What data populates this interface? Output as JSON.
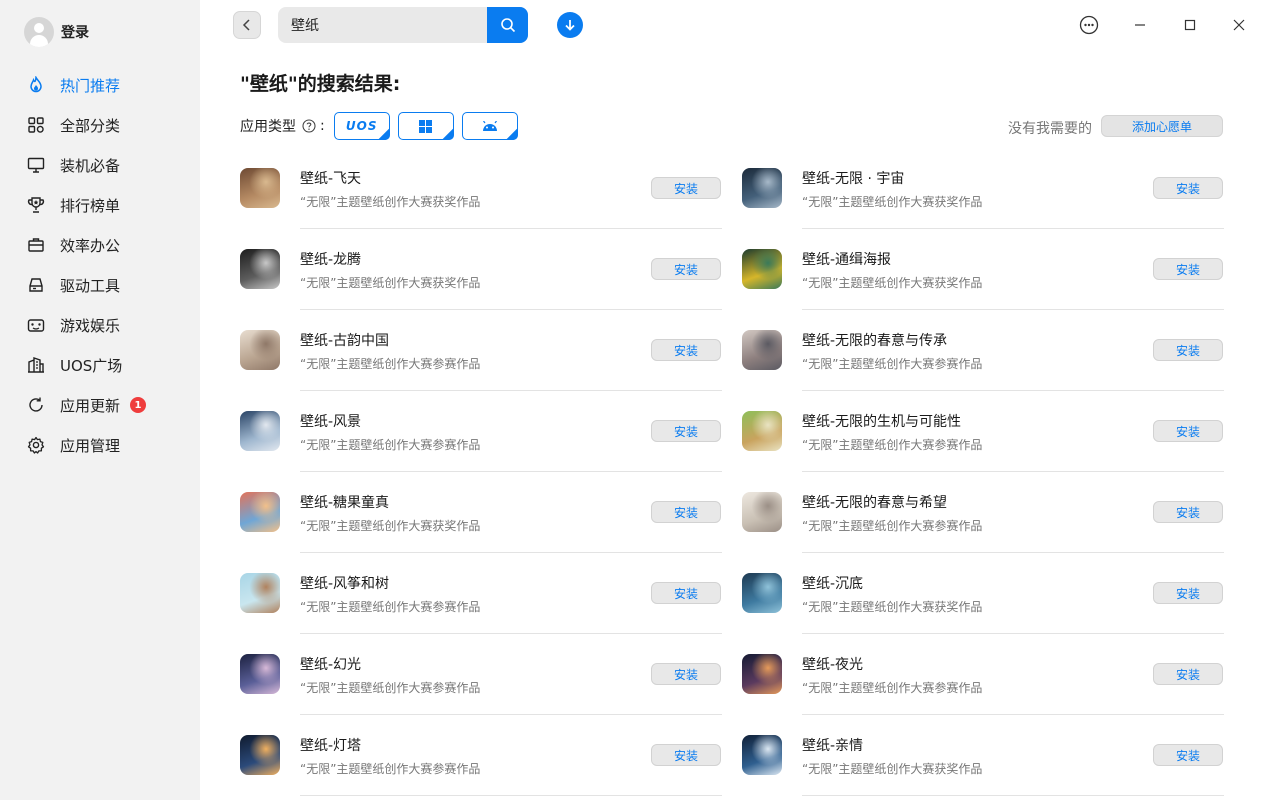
{
  "sidebar": {
    "login_label": "登录",
    "items": [
      {
        "label": "热门推荐",
        "icon": "flame-icon",
        "active": true
      },
      {
        "label": "全部分类",
        "icon": "grid-icon"
      },
      {
        "label": "装机必备",
        "icon": "monitor-icon"
      },
      {
        "label": "排行榜单",
        "icon": "trophy-icon"
      },
      {
        "label": "效率办公",
        "icon": "briefcase-icon"
      },
      {
        "label": "驱动工具",
        "icon": "drive-icon"
      },
      {
        "label": "游戏娱乐",
        "icon": "gamepad-icon"
      },
      {
        "label": "UOS广场",
        "icon": "buildings-icon"
      },
      {
        "label": "应用更新",
        "icon": "refresh-icon",
        "badge": "1"
      },
      {
        "label": "应用管理",
        "icon": "gear-icon"
      }
    ]
  },
  "search": {
    "value": "壁纸"
  },
  "results": {
    "title": "\"壁纸\"的搜索结果:",
    "filter_label": "应用类型",
    "filter_colon": ":",
    "type_chips": [
      {
        "label": "UOS",
        "icon": "uos-logo"
      },
      {
        "label": "",
        "icon": "windows-icon"
      },
      {
        "label": "",
        "icon": "android-icon"
      }
    ],
    "wish_text": "没有我需要的",
    "wish_button": "添加心愿单"
  },
  "install_label": "安装",
  "apps": [
    {
      "name": "壁纸-飞天",
      "desc": "“无限”主题壁纸创作大赛获奖作品",
      "colors": [
        "#6e4a33",
        "#b58a63",
        "#d9b98f"
      ]
    },
    {
      "name": "壁纸-无限 · 宇宙",
      "desc": "“无限”主题壁纸创作大赛获奖作品",
      "colors": [
        "#1b2a3a",
        "#44607a",
        "#a7b9c9"
      ]
    },
    {
      "name": "壁纸-龙腾",
      "desc": "“无限”主题壁纸创作大赛获奖作品",
      "colors": [
        "#1d1d1d",
        "#5d5d5d",
        "#c8c8c8"
      ]
    },
    {
      "name": "壁纸-通缉海报",
      "desc": "“无限”主题壁纸创作大赛获奖作品",
      "colors": [
        "#1a3a2e",
        "#d6b62a",
        "#3a7a5a"
      ]
    },
    {
      "name": "壁纸-古韵中国",
      "desc": "“无限”主题壁纸创作大赛参赛作品",
      "colors": [
        "#e8ddd0",
        "#b9a490",
        "#8f7868"
      ]
    },
    {
      "name": "壁纸-无限的春意与传承",
      "desc": "“无限”主题壁纸创作大赛参赛作品",
      "colors": [
        "#d3c9c3",
        "#8d7f7e",
        "#5b5a62"
      ]
    },
    {
      "name": "壁纸-风景",
      "desc": "“无限”主题壁纸创作大赛参赛作品",
      "colors": [
        "#2a4466",
        "#9fb7cf",
        "#e2e8ef"
      ]
    },
    {
      "name": "壁纸-无限的生机与可能性",
      "desc": "“无限”主题壁纸创作大赛参赛作品",
      "colors": [
        "#8fbf5a",
        "#c9a35e",
        "#e9e3c2"
      ]
    },
    {
      "name": "壁纸-糖果童真",
      "desc": "“无限”主题壁纸创作大赛获奖作品",
      "colors": [
        "#e2735a",
        "#6fa6d6",
        "#f2c08a"
      ]
    },
    {
      "name": "壁纸-无限的春意与希望",
      "desc": "“无限”主题壁纸创作大赛参赛作品",
      "colors": [
        "#eee8e0",
        "#c9c0b4",
        "#9b8f86"
      ]
    },
    {
      "name": "壁纸-风筝和树",
      "desc": "“无限”主题壁纸创作大赛参赛作品",
      "colors": [
        "#a8d5e6",
        "#c9e6ef",
        "#b0825e"
      ]
    },
    {
      "name": "壁纸-沉底",
      "desc": "“无限”主题壁纸创作大赛获奖作品",
      "colors": [
        "#1e3a52",
        "#3e7aa0",
        "#8fc2d9"
      ]
    },
    {
      "name": "壁纸-幻光",
      "desc": "“无限”主题壁纸创作大赛参赛作品",
      "colors": [
        "#1c2140",
        "#5a5f98",
        "#d7b9d8"
      ]
    },
    {
      "name": "壁纸-夜光",
      "desc": "“无限”主题壁纸创作大赛参赛作品",
      "colors": [
        "#151a33",
        "#5a3a5e",
        "#e59a5a"
      ]
    },
    {
      "name": "壁纸-灯塔",
      "desc": "“无限”主题壁纸创作大赛参赛作品",
      "colors": [
        "#0f1a2e",
        "#2b4a7a",
        "#f0b060"
      ]
    },
    {
      "name": "壁纸-亲情",
      "desc": "“无限”主题壁纸创作大赛获奖作品",
      "colors": [
        "#102038",
        "#2f5f8f",
        "#dbe7f2"
      ]
    }
  ],
  "colors": {
    "accent": "#0a7cf0",
    "sidebar_bg": "#f2f2f2",
    "badge": "#ef3d3d"
  }
}
